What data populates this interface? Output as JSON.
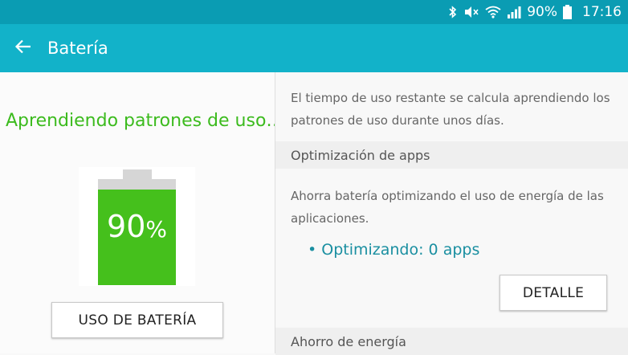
{
  "status_bar": {
    "battery_percent": "90%",
    "time": "17:16",
    "icons": [
      "bluetooth-icon",
      "mute-icon",
      "wifi-icon",
      "signal-icon",
      "battery-icon"
    ]
  },
  "app_bar": {
    "title": "Batería",
    "back_icon": "arrow-left-icon"
  },
  "left_pane": {
    "status_text": "Aprendiendo patrones de uso…",
    "battery_level": 0.9,
    "battery_number": "90",
    "battery_unit": "%",
    "usage_button_label": "USO DE BATERÍA"
  },
  "right_pane": {
    "info_text": "El tiempo de uso restante se calcula aprendiendo los patrones de uso durante unos días.",
    "optimization": {
      "header": "Optimización de apps",
      "description": "Ahorra batería optimizando el uso de energía de las aplicaciones.",
      "status": "• Optimizando: 0 apps",
      "detail_button_label": "DETALLE"
    },
    "power_saving": {
      "header": "Ahorro de energía"
    }
  },
  "colors": {
    "status_bar": "#0a9cb3",
    "app_bar": "#12b2c9",
    "accent_green": "#3cbb1e",
    "battery_fill": "#45c01c",
    "link_teal": "#1a8fa1"
  }
}
